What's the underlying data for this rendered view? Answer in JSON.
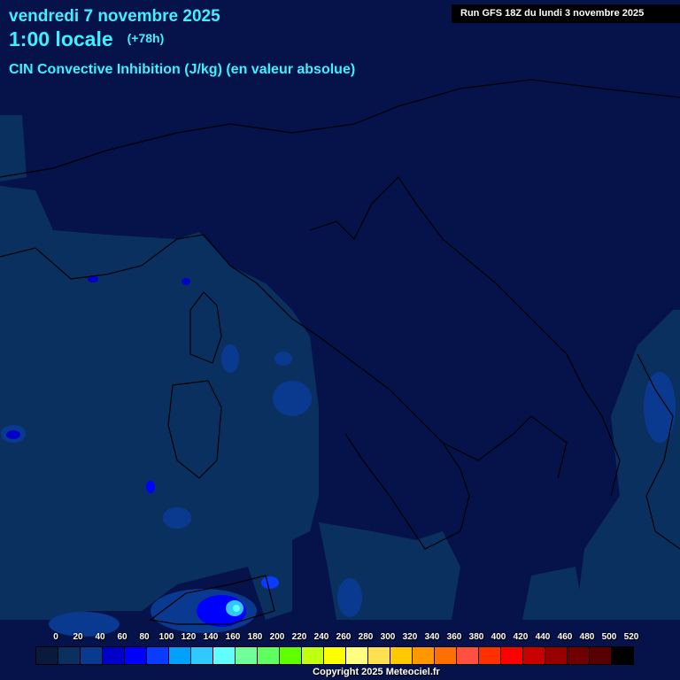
{
  "header": {
    "date": "vendredi 7 novembre 2025",
    "time": "1:00 locale",
    "lead": "(+78h)",
    "parameter": "CIN Convective Inhibition (J/kg) (en valeur absolue)",
    "run": "Run GFS 18Z du lundi 3 novembre 2025"
  },
  "legend": {
    "labels": [
      "0",
      "20",
      "40",
      "60",
      "80",
      "100",
      "120",
      "140",
      "160",
      "180",
      "200",
      "220",
      "240",
      "260",
      "280",
      "300",
      "320",
      "340",
      "360",
      "380",
      "400",
      "420",
      "440",
      "460",
      "480",
      "500",
      "520"
    ],
    "colors": [
      "#0a1a3c",
      "#0a3060",
      "#0a3a90",
      "#0000c8",
      "#0000ff",
      "#0a3cff",
      "#00a0ff",
      "#30c8ff",
      "#60ffff",
      "#70ff98",
      "#60ff60",
      "#60ff00",
      "#c0ff10",
      "#ffff00",
      "#ffff80",
      "#ffe050",
      "#ffc800",
      "#ff9800",
      "#ff7000",
      "#ff5040",
      "#ff3000",
      "#ff0000",
      "#c80000",
      "#980000",
      "#700000",
      "#580000",
      "#000000"
    ]
  },
  "copyright": "Copyright 2025 Meteociel.fr"
}
